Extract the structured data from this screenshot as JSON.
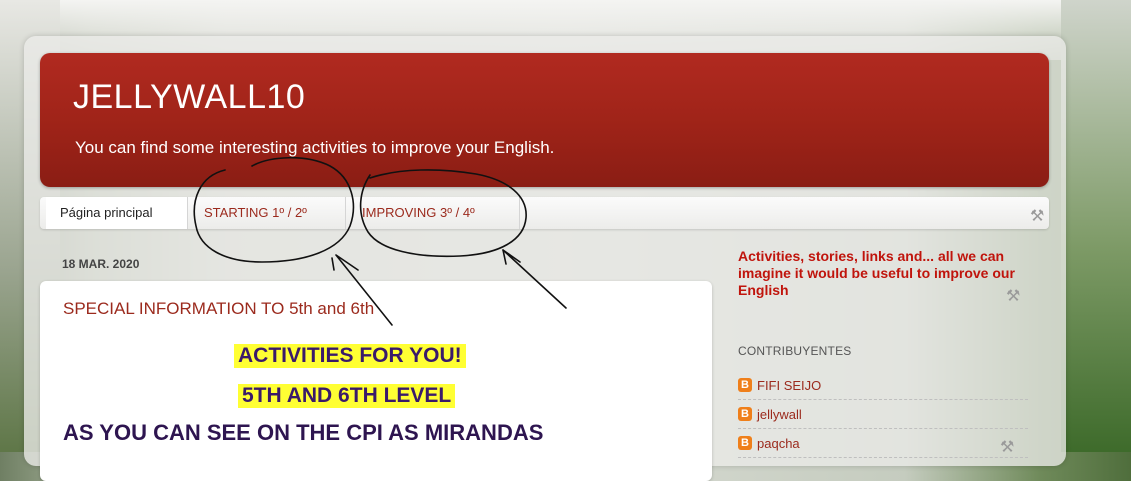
{
  "blog": {
    "title": "JELLYWALL10",
    "description": "You can find some interesting activities to improve your English."
  },
  "tabs": [
    {
      "label": "Página principal",
      "selected": true
    },
    {
      "label": "STARTING 1º / 2º",
      "selected": false
    },
    {
      "label": "IMPROVING 3º / 4º",
      "selected": false
    }
  ],
  "post": {
    "date": "18 MAR. 2020",
    "title": "SPECIAL INFORMATION TO 5th and 6th",
    "highlight_line_1": "ACTIVITIES FOR YOU!",
    "highlight_line_2": "5TH AND 6TH LEVEL",
    "body_line": "AS YOU CAN SEE ON THE CPI AS MIRANDAS"
  },
  "sidebar": {
    "description": "Activities, stories, links and... all we can imagine it would be useful to improve our English",
    "contributors_title": "CONTRIBUYENTES",
    "contributors": [
      {
        "name": "FIFI SEIJO"
      },
      {
        "name": "jellywall"
      },
      {
        "name": "paqcha"
      }
    ]
  },
  "icons": {
    "edit": "wrench-screwdriver-icon",
    "blogger": "blogger-icon"
  },
  "colors": {
    "header_red": "#9e2318",
    "link_red": "#9b2a1d",
    "sidebar_red": "#c0140c",
    "highlight": "#ffff33",
    "blogger_orange": "#ef7f1a"
  }
}
